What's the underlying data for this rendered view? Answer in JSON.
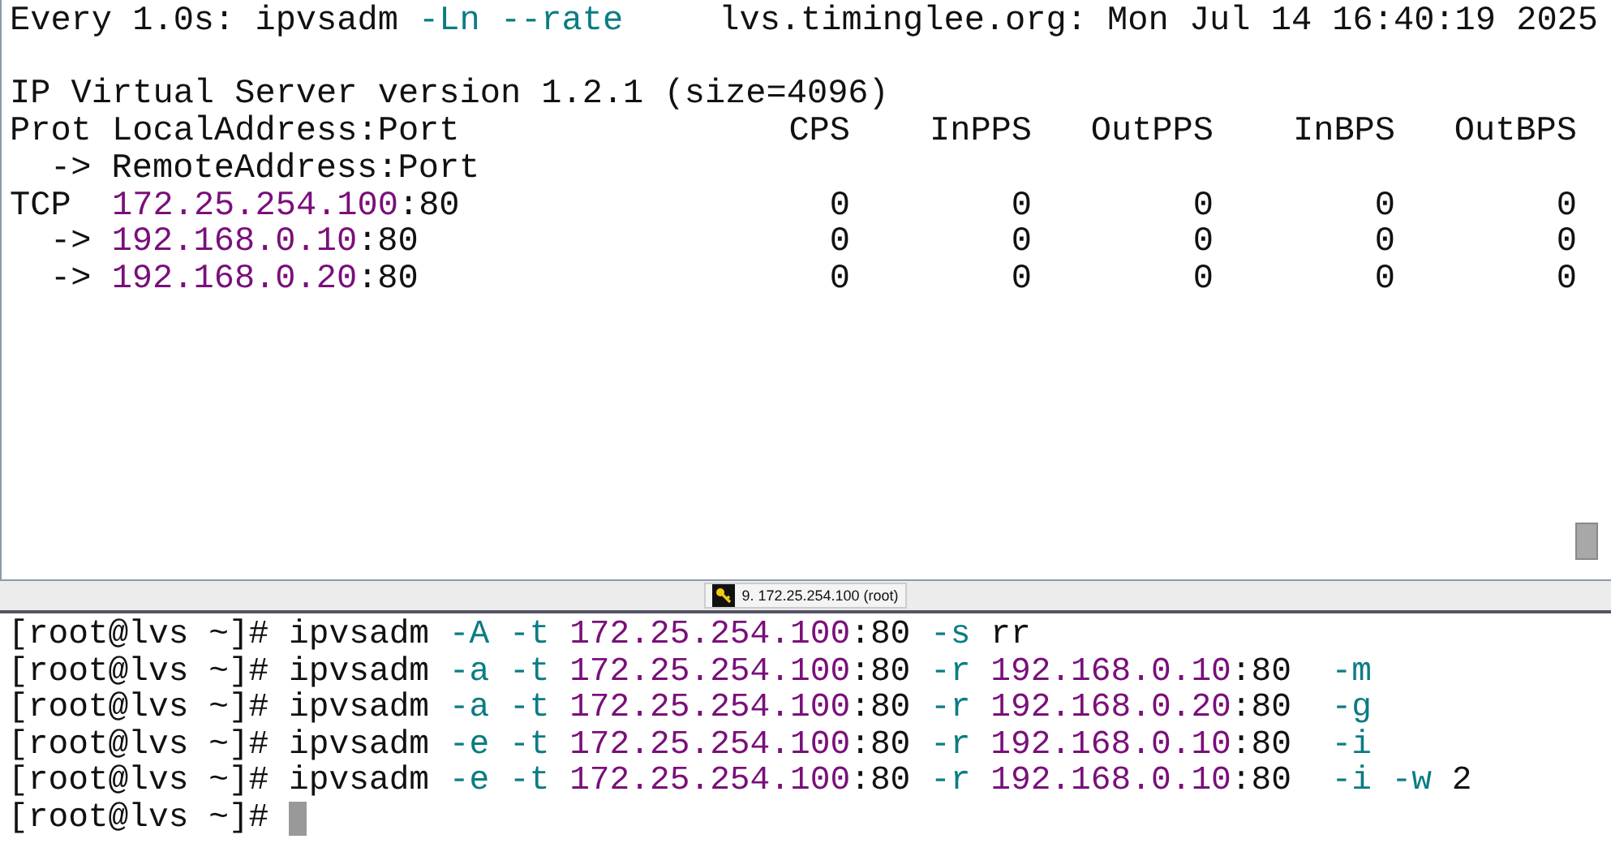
{
  "watch_pane": {
    "header": {
      "command": [
        {
          "text": "Every 1.0s: ipvsadm ",
          "kind": "plain"
        },
        {
          "text": "-Ln --rate",
          "kind": "option"
        }
      ],
      "host_time": "lvs.timinglee.org: Mon Jul 14 16:40:19 2025"
    },
    "version_line": "IP Virtual Server version 1.2.1 (size=4096)",
    "table": {
      "columns": [
        "Prot LocalAddress:Port",
        "CPS",
        "InPPS",
        "OutPPS",
        "InBPS",
        "OutBPS"
      ],
      "subheader": "-> RemoteAddress:Port",
      "rows": [
        {
          "kind": "service",
          "protocol": "TCP",
          "address": "172.25.254.100",
          "port": ":80",
          "values": [
            "0",
            "0",
            "0",
            "0",
            "0"
          ]
        },
        {
          "kind": "real",
          "protocol": "->",
          "address": "192.168.0.10",
          "port": ":80",
          "values": [
            "0",
            "0",
            "0",
            "0",
            "0"
          ]
        },
        {
          "kind": "real",
          "protocol": "->",
          "address": "192.168.0.20",
          "port": ":80",
          "values": [
            "0",
            "0",
            "0",
            "0",
            "0"
          ]
        }
      ]
    }
  },
  "tab_bar": {
    "label": "9. 172.25.254.100 (root)"
  },
  "shell": {
    "lines": [
      {
        "prompt": "[root@lvs ~]#",
        "tokens": [
          {
            "text": "ipvsadm ",
            "kind": "plain"
          },
          {
            "text": "-A -t ",
            "kind": "option"
          },
          {
            "text": "172.25.254.100",
            "kind": "address"
          },
          {
            "text": ":80 ",
            "kind": "plain"
          },
          {
            "text": "-s ",
            "kind": "option"
          },
          {
            "text": "rr",
            "kind": "plain"
          }
        ]
      },
      {
        "prompt": "[root@lvs ~]#",
        "tokens": [
          {
            "text": "ipvsadm ",
            "kind": "plain"
          },
          {
            "text": "-a -t ",
            "kind": "option"
          },
          {
            "text": "172.25.254.100",
            "kind": "address"
          },
          {
            "text": ":80 ",
            "kind": "plain"
          },
          {
            "text": "-r ",
            "kind": "option"
          },
          {
            "text": "192.168.0.10",
            "kind": "address"
          },
          {
            "text": ":80  ",
            "kind": "plain"
          },
          {
            "text": "-m",
            "kind": "option"
          }
        ]
      },
      {
        "prompt": "[root@lvs ~]#",
        "tokens": [
          {
            "text": "ipvsadm ",
            "kind": "plain"
          },
          {
            "text": "-a -t ",
            "kind": "option"
          },
          {
            "text": "172.25.254.100",
            "kind": "address"
          },
          {
            "text": ":80 ",
            "kind": "plain"
          },
          {
            "text": "-r ",
            "kind": "option"
          },
          {
            "text": "192.168.0.20",
            "kind": "address"
          },
          {
            "text": ":80  ",
            "kind": "plain"
          },
          {
            "text": "-g",
            "kind": "option"
          }
        ]
      },
      {
        "prompt": "[root@lvs ~]#",
        "tokens": [
          {
            "text": "ipvsadm ",
            "kind": "plain"
          },
          {
            "text": "-e -t ",
            "kind": "option"
          },
          {
            "text": "172.25.254.100",
            "kind": "address"
          },
          {
            "text": ":80 ",
            "kind": "plain"
          },
          {
            "text": "-r ",
            "kind": "option"
          },
          {
            "text": "192.168.0.10",
            "kind": "address"
          },
          {
            "text": ":80  ",
            "kind": "plain"
          },
          {
            "text": "-i",
            "kind": "option"
          }
        ]
      },
      {
        "prompt": "[root@lvs ~]#",
        "tokens": [
          {
            "text": "ipvsadm ",
            "kind": "plain"
          },
          {
            "text": "-e -t ",
            "kind": "option"
          },
          {
            "text": "172.25.254.100",
            "kind": "address"
          },
          {
            "text": ":80 ",
            "kind": "plain"
          },
          {
            "text": "-r ",
            "kind": "option"
          },
          {
            "text": "192.168.0.10",
            "kind": "address"
          },
          {
            "text": ":80  ",
            "kind": "plain"
          },
          {
            "text": "-i -w ",
            "kind": "option"
          },
          {
            "text": "2",
            "kind": "plain"
          }
        ]
      },
      {
        "prompt": "[root@lvs ~]#",
        "cursor": true
      }
    ]
  }
}
